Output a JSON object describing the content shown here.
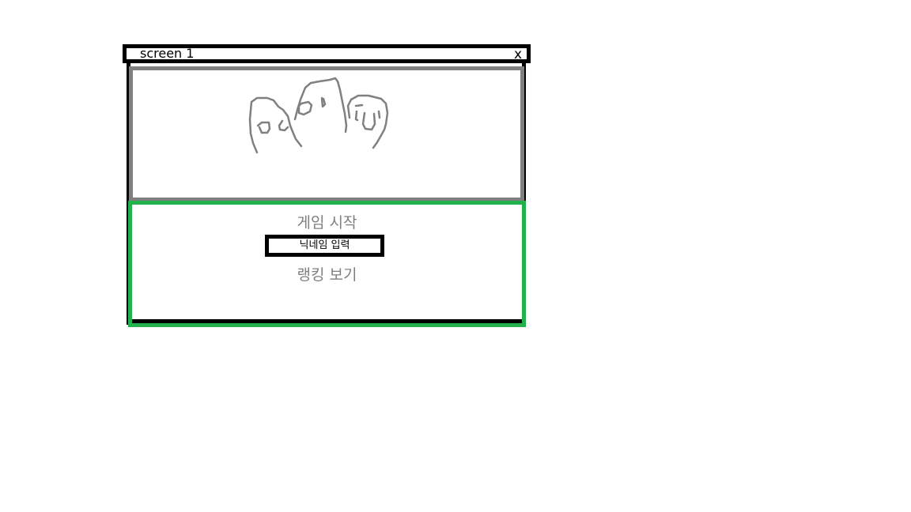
{
  "window": {
    "title": "screen 1",
    "close_label": "x"
  },
  "illustration": {
    "icon": "ghost-doodle-icon"
  },
  "menu": {
    "start_label": "게임 시작",
    "nickname_label": "닉네임 입력",
    "ranking_label": "랭킹 보기"
  },
  "colors": {
    "image_border": "#7f7f7f",
    "menu_border": "#22b14c",
    "menu_text": "#7f7f7f"
  }
}
